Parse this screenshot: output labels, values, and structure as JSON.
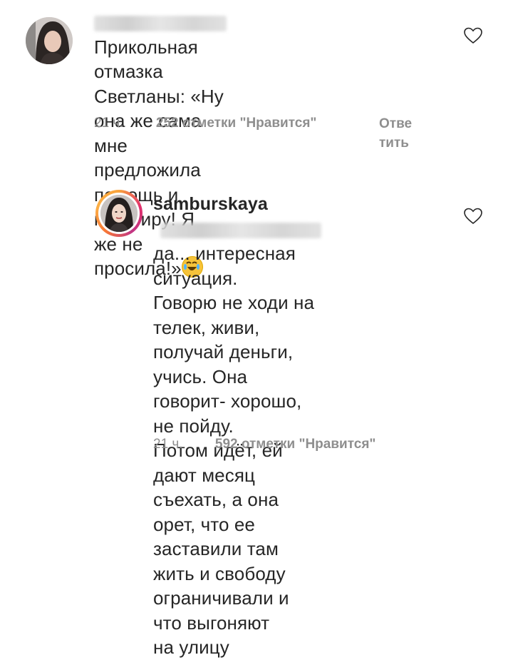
{
  "comments": [
    {
      "username_hidden": true,
      "lines": [
        "Прикольная отмазка",
        "Светланы: «Ну она же сама мне",
        "предложила помощь и квартиру! Я",
        "же не просила!»"
      ],
      "emoji": "rolling-on-floor-laughing",
      "time": "21 ч.",
      "likes": "252 отметки \"Нравится\"",
      "reply_lines": [
        "Отве",
        "тить"
      ]
    },
    {
      "username": "samburskaya",
      "mention_hidden": true,
      "lines": [
        "да... интересная ситуация.",
        "Говорю не ходи на телек, живи,",
        "получай деньги, учись. Она",
        "говорит- хорошо, не пойду.",
        "Потом идёт, ей дают месяц",
        "съехать, а она орет, что ее",
        "заставили там жить и свободу",
        "ограничивали и что выгоняют",
        "на улицу"
      ],
      "time": "21 ч.",
      "likes": "592 отметки \"Нравится\""
    }
  ]
}
